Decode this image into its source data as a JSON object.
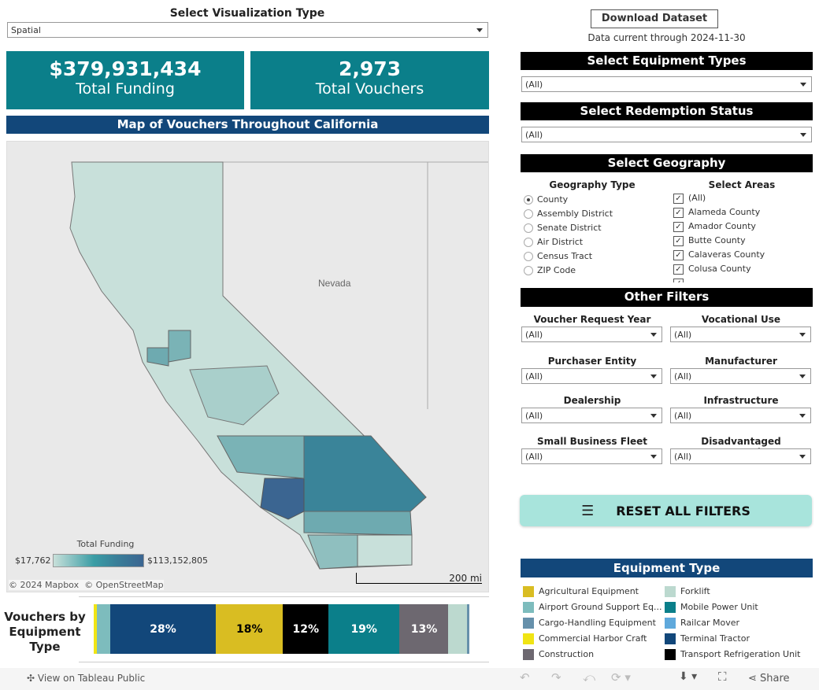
{
  "viz_type": {
    "label": "Select Visualization Type",
    "value": "Spatial"
  },
  "kpis": {
    "funding": {
      "value": "$379,931,434",
      "label": "Total Funding"
    },
    "vouchers": {
      "value": "2,973",
      "label": "Total Vouchers"
    }
  },
  "map": {
    "title": "Map of Vouchers Throughout California",
    "state_label": "Nevada",
    "legend_title": "Total Funding",
    "legend_min": "$17,762",
    "legend_max": "$113,152,805",
    "attribution": "© 2024 Mapbox  © OpenStreetMap",
    "scale": "200 mi",
    "colors": {
      "low": "#c8e0da",
      "high": "#3b6591"
    }
  },
  "download": {
    "label": "Download Dataset",
    "note": "Data current through 2024-11-30"
  },
  "equipment_filter": {
    "title": "Select Equipment Types",
    "value": "(All)"
  },
  "redemption_filter": {
    "title": "Select Redemption Status",
    "value": "(All)"
  },
  "geography": {
    "title": "Select Geography",
    "type_label": "Geography Type",
    "types": [
      "County",
      "Assembly District",
      "Senate District",
      "Air District",
      "Census Tract",
      "ZIP Code"
    ],
    "selected": "County",
    "areas_label": "Select Areas",
    "areas": [
      "(All)",
      "Alameda County",
      "Amador County",
      "Butte County",
      "Calaveras County",
      "Colusa County"
    ]
  },
  "other_filters": {
    "title": "Other Filters",
    "items": [
      {
        "label": "Voucher Request Year",
        "value": "(All)"
      },
      {
        "label": "Vocational Use",
        "value": "(All)"
      },
      {
        "label": "Purchaser Entity",
        "value": "(All)"
      },
      {
        "label": "Manufacturer",
        "value": "(All)"
      },
      {
        "label": "Dealership",
        "value": "(All)"
      },
      {
        "label": "Infrastructure",
        "value": "(All)"
      },
      {
        "label": "Small Business Fleet",
        "value": "(All)"
      },
      {
        "label": "Disadvantaged Community",
        "value": "(All)"
      }
    ]
  },
  "reset": {
    "label": "RESET ALL FILTERS"
  },
  "equipment_legend": {
    "title": "Equipment Type",
    "items": [
      {
        "name": "Agricultural Equipment",
        "color": "#d9bd22"
      },
      {
        "name": "Forklift",
        "color": "#bcd9cf"
      },
      {
        "name": "Airport Ground Support Eq...",
        "color": "#7dbcbd"
      },
      {
        "name": "Mobile Power Unit",
        "color": "#0b7f8a"
      },
      {
        "name": "Cargo-Handling Equipment",
        "color": "#6690ab"
      },
      {
        "name": "Railcar Mover",
        "color": "#5fa9dc"
      },
      {
        "name": "Commercial Harbor Craft",
        "color": "#f0e414"
      },
      {
        "name": "Terminal Tractor",
        "color": "#12477a"
      },
      {
        "name": "Construction",
        "color": "#6d6870"
      },
      {
        "name": "Transport Refrigeration Unit",
        "color": "#000000"
      }
    ]
  },
  "vouchers_bar": {
    "title": "Vouchers by Equipment Type",
    "segments": [
      {
        "type": "Commercial Harbor Craft",
        "pct": 0.8,
        "label": "",
        "color": "#f0e414"
      },
      {
        "type": "Airport Ground Support Equipment",
        "pct": 3.6,
        "label": "",
        "color": "#7dbcbd"
      },
      {
        "type": "Terminal Tractor",
        "pct": 28,
        "label": "28%",
        "color": "#12477a"
      },
      {
        "type": "Agricultural Equipment",
        "pct": 18,
        "label": "18%",
        "color": "#d9bd22",
        "text": "#000"
      },
      {
        "type": "Transport Refrigeration Unit",
        "pct": 12,
        "label": "12%",
        "color": "#000000"
      },
      {
        "type": "Mobile Power Unit",
        "pct": 19,
        "label": "19%",
        "color": "#0b7f8a"
      },
      {
        "type": "Construction",
        "pct": 13,
        "label": "13%",
        "color": "#6d6870"
      },
      {
        "type": "Forklift",
        "pct": 5,
        "label": "",
        "color": "#bcd9cf"
      },
      {
        "type": "Cargo-Handling Equipment",
        "pct": 0.6,
        "label": "",
        "color": "#6690ab"
      }
    ]
  },
  "toolbar": {
    "view_label": "View on Tableau Public",
    "share": "Share"
  }
}
